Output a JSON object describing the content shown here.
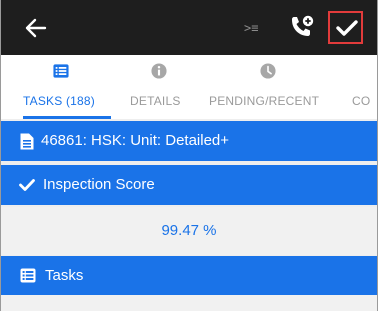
{
  "tabs": [
    {
      "label": "TASKS (188)",
      "icon": "list-icon",
      "active": true
    },
    {
      "label": "DETAILS",
      "icon": "info-icon",
      "active": false
    },
    {
      "label": "PENDING/RECENT",
      "icon": "clock-icon",
      "active": false
    },
    {
      "label": "CO",
      "icon": "",
      "active": false
    }
  ],
  "header_bar": {
    "label": "46861: HSK: Unit: Detailed+",
    "icon": "document-icon"
  },
  "inspection": {
    "label": "Inspection Score",
    "icon": "checkmark-icon",
    "score": "99.47 %"
  },
  "tasks_bar": {
    "label": "Tasks",
    "icon": "list-icon"
  },
  "colors": {
    "accent": "#1a73e8",
    "topbar": "#1e1e1e",
    "highlight_border": "#e23b3b"
  }
}
